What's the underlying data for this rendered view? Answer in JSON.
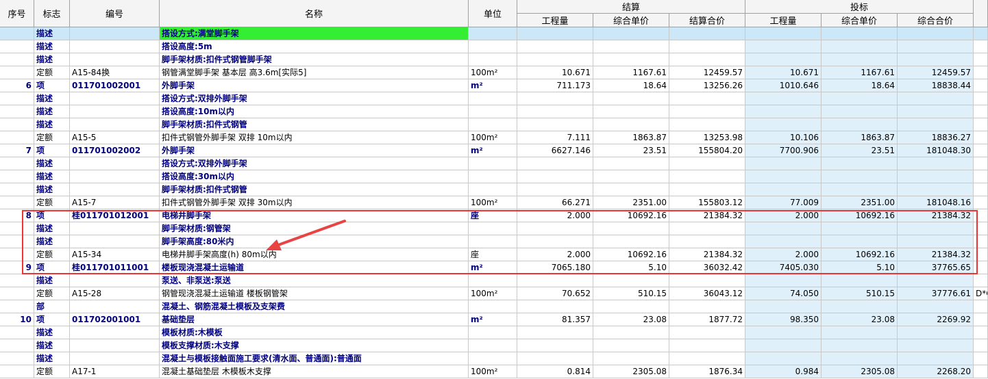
{
  "header": {
    "seq": "序号",
    "flag": "标志",
    "code": "编号",
    "name": "名称",
    "unit": "单位",
    "settle": "结算",
    "bid": "投标",
    "qty": "工程量",
    "price": "综合单价",
    "settle_total": "结算合价",
    "bid_qty": "工程量",
    "bid_price": "综合单价",
    "bid_total": "综合合价"
  },
  "rows": [
    {
      "seq": "",
      "flag": "描述",
      "code": "",
      "name": "搭设方式:满堂脚手架",
      "unit": "",
      "q1": "",
      "p1": "",
      "t1": "",
      "q2": "",
      "p2": "",
      "t2": "",
      "x": "",
      "bold": true,
      "selected": true
    },
    {
      "seq": "",
      "flag": "描述",
      "code": "",
      "name": "搭设高度:5m",
      "unit": "",
      "q1": "",
      "p1": "",
      "t1": "",
      "q2": "",
      "p2": "",
      "t2": "",
      "x": "",
      "bold": true
    },
    {
      "seq": "",
      "flag": "描述",
      "code": "",
      "name": "脚手架材质:扣件式钢管脚手架",
      "unit": "",
      "q1": "",
      "p1": "",
      "t1": "",
      "q2": "",
      "p2": "",
      "t2": "",
      "x": "",
      "bold": true
    },
    {
      "seq": "",
      "flag": "定额",
      "code": "A15-84换",
      "name": "钢管满堂脚手架 基本层 高3.6m[实际5]",
      "unit": "100m²",
      "q1": "10.671",
      "p1": "1167.61",
      "t1": "12459.57",
      "q2": "10.671",
      "p2": "1167.61",
      "t2": "12459.57",
      "x": "",
      "bold": false
    },
    {
      "seq": "6",
      "flag": "项",
      "code": "011701002001",
      "name": "外脚手架",
      "unit": "m²",
      "q1": "711.173",
      "p1": "18.64",
      "t1": "13256.26",
      "q2": "1010.646",
      "p2": "18.64",
      "t2": "18838.44",
      "x": "",
      "bold": true
    },
    {
      "seq": "",
      "flag": "描述",
      "code": "",
      "name": "搭设方式:双排外脚手架",
      "unit": "",
      "q1": "",
      "p1": "",
      "t1": "",
      "q2": "",
      "p2": "",
      "t2": "",
      "x": "",
      "bold": true
    },
    {
      "seq": "",
      "flag": "描述",
      "code": "",
      "name": "搭设高度:10m以内",
      "unit": "",
      "q1": "",
      "p1": "",
      "t1": "",
      "q2": "",
      "p2": "",
      "t2": "",
      "x": "",
      "bold": true
    },
    {
      "seq": "",
      "flag": "描述",
      "code": "",
      "name": "脚手架材质:扣件式钢管",
      "unit": "",
      "q1": "",
      "p1": "",
      "t1": "",
      "q2": "",
      "p2": "",
      "t2": "",
      "x": "",
      "bold": true
    },
    {
      "seq": "",
      "flag": "定额",
      "code": "A15-5",
      "name": "扣件式钢管外脚手架 双排 10m以内",
      "unit": "100m²",
      "q1": "7.111",
      "p1": "1863.87",
      "t1": "13253.98",
      "q2": "10.106",
      "p2": "1863.87",
      "t2": "18836.27",
      "x": "",
      "bold": false
    },
    {
      "seq": "7",
      "flag": "项",
      "code": "011701002002",
      "name": "外脚手架",
      "unit": "m²",
      "q1": "6627.146",
      "p1": "23.51",
      "t1": "155804.20",
      "q2": "7700.906",
      "p2": "23.51",
      "t2": "181048.30",
      "x": "",
      "bold": true
    },
    {
      "seq": "",
      "flag": "描述",
      "code": "",
      "name": "搭设方式:双排外脚手架",
      "unit": "",
      "q1": "",
      "p1": "",
      "t1": "",
      "q2": "",
      "p2": "",
      "t2": "",
      "x": "",
      "bold": true
    },
    {
      "seq": "",
      "flag": "描述",
      "code": "",
      "name": "搭设高度:30m以内",
      "unit": "",
      "q1": "",
      "p1": "",
      "t1": "",
      "q2": "",
      "p2": "",
      "t2": "",
      "x": "",
      "bold": true
    },
    {
      "seq": "",
      "flag": "描述",
      "code": "",
      "name": "脚手架材质:扣件式钢管",
      "unit": "",
      "q1": "",
      "p1": "",
      "t1": "",
      "q2": "",
      "p2": "",
      "t2": "",
      "x": "",
      "bold": true
    },
    {
      "seq": "",
      "flag": "定额",
      "code": "A15-7",
      "name": "扣件式钢管外脚手架 双排 30m以内",
      "unit": "100m²",
      "q1": "66.271",
      "p1": "2351.00",
      "t1": "155803.12",
      "q2": "77.009",
      "p2": "2351.00",
      "t2": "181048.16",
      "x": "",
      "bold": false
    },
    {
      "seq": "8",
      "flag": "项",
      "code": "桂011701012001",
      "name": "电梯井脚手架",
      "unit": "座",
      "q1": "2.000",
      "p1": "10692.16",
      "t1": "21384.32",
      "q2": "2.000",
      "p2": "10692.16",
      "t2": "21384.32",
      "x": "",
      "bold": true
    },
    {
      "seq": "",
      "flag": "描述",
      "code": "",
      "name": "脚手架材质:钢管架",
      "unit": "",
      "q1": "",
      "p1": "",
      "t1": "",
      "q2": "",
      "p2": "",
      "t2": "",
      "x": "",
      "bold": true
    },
    {
      "seq": "",
      "flag": "描述",
      "code": "",
      "name": "脚手架高度:80米内",
      "unit": "",
      "q1": "",
      "p1": "",
      "t1": "",
      "q2": "",
      "p2": "",
      "t2": "",
      "x": "",
      "bold": true
    },
    {
      "seq": "",
      "flag": "定额",
      "code": "A15-34",
      "name": "电梯井脚手架高度(h) 80m以内",
      "unit": "座",
      "q1": "2.000",
      "p1": "10692.16",
      "t1": "21384.32",
      "q2": "2.000",
      "p2": "10692.16",
      "t2": "21384.32",
      "x": "",
      "bold": false
    },
    {
      "seq": "9",
      "flag": "项",
      "code": "桂011701011001",
      "name": "楼板现浇混凝土运输道",
      "unit": "m²",
      "q1": "7065.180",
      "p1": "5.10",
      "t1": "36032.42",
      "q2": "7405.030",
      "p2": "5.10",
      "t2": "37765.65",
      "x": "",
      "bold": true
    },
    {
      "seq": "",
      "flag": "描述",
      "code": "",
      "name": "泵送、非泵送:泵送",
      "unit": "",
      "q1": "",
      "p1": "",
      "t1": "",
      "q2": "",
      "p2": "",
      "t2": "",
      "x": "",
      "bold": true
    },
    {
      "seq": "",
      "flag": "定额",
      "code": "A15-28",
      "name": "钢管现浇混凝土运输道 楼板钢管架",
      "unit": "100m²",
      "q1": "70.652",
      "p1": "510.15",
      "t1": "36043.12",
      "q2": "74.050",
      "p2": "510.15",
      "t2": "37776.61",
      "x": "D*C",
      "bold": false
    },
    {
      "seq": "",
      "flag": "部",
      "code": "",
      "name": "混凝土、钢筋混凝土模板及支架费",
      "unit": "",
      "q1": "",
      "p1": "",
      "t1": "",
      "q2": "",
      "p2": "",
      "t2": "",
      "x": "",
      "bold": true
    },
    {
      "seq": "10",
      "flag": "项",
      "code": "011702001001",
      "name": "基础垫层",
      "unit": "m²",
      "q1": "81.357",
      "p1": "23.08",
      "t1": "1877.72",
      "q2": "98.350",
      "p2": "23.08",
      "t2": "2269.92",
      "x": "",
      "bold": true
    },
    {
      "seq": "",
      "flag": "描述",
      "code": "",
      "name": "模板材质:木模板",
      "unit": "",
      "q1": "",
      "p1": "",
      "t1": "",
      "q2": "",
      "p2": "",
      "t2": "",
      "x": "",
      "bold": true
    },
    {
      "seq": "",
      "flag": "描述",
      "code": "",
      "name": "模板支撑材质:木支撑",
      "unit": "",
      "q1": "",
      "p1": "",
      "t1": "",
      "q2": "",
      "p2": "",
      "t2": "",
      "x": "",
      "bold": true
    },
    {
      "seq": "",
      "flag": "描述",
      "code": "",
      "name": "混凝土与模板接触面施工要求(清水面、普通面):普通面",
      "unit": "",
      "q1": "",
      "p1": "",
      "t1": "",
      "q2": "",
      "p2": "",
      "t2": "",
      "x": "",
      "bold": true
    },
    {
      "seq": "",
      "flag": "定额",
      "code": "A17-1",
      "name": "混凝土基础垫层 木模板木支撑",
      "unit": "100m²",
      "q1": "0.814",
      "p1": "2305.08",
      "t1": "1876.34",
      "q2": "0.984",
      "p2": "2305.08",
      "t2": "2268.20",
      "x": "",
      "bold": false
    }
  ],
  "colors": {
    "selected_row": "#cce8f8",
    "selected_name": "#33ee33",
    "bid_bg": "#dff0fa",
    "highlight": "#ee3333",
    "bold_text": "#000080"
  },
  "annotations": [
    "red-highlight-box",
    "red-arrow"
  ]
}
